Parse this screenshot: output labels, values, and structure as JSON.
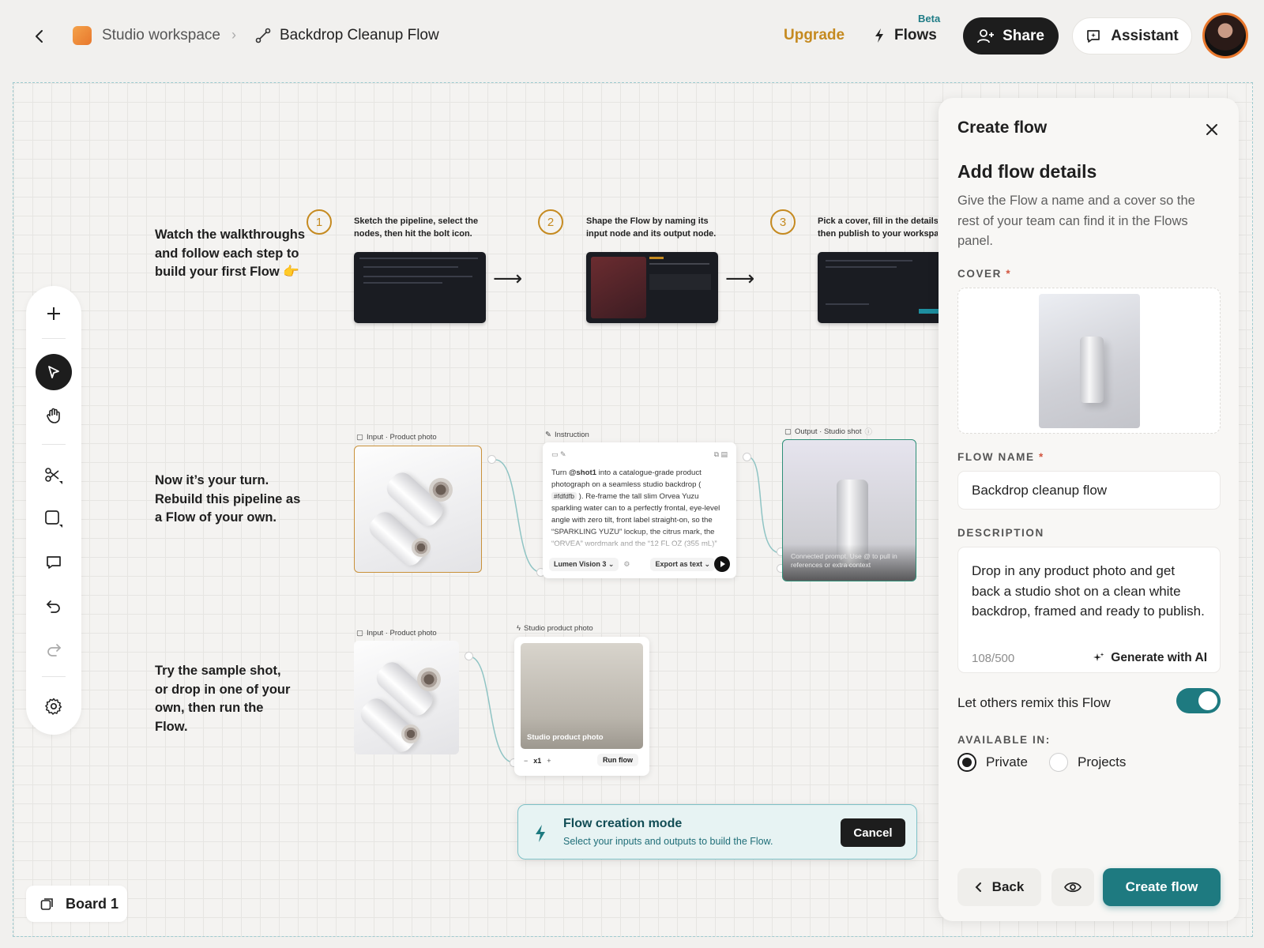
{
  "header": {
    "workspace_name": "Studio workspace",
    "flow_title": "Backdrop Cleanup Flow",
    "upgrade_label": "Upgrade",
    "flows_label": "Flows",
    "flows_badge": "Beta",
    "share_label": "Share",
    "assistant_label": "Assistant"
  },
  "canvas": {
    "captions": {
      "intro": "Watch the walkthroughs and follow each step to build your first Flow 👉",
      "turn": "Now it’s your turn. Rebuild this pipeline as a Flow of your own.",
      "try": "Try the sample shot, or drop in one of your own, then run the Flow."
    },
    "steps": [
      {
        "num": "1",
        "text": "Sketch the pipeline, select the nodes, then hit the bolt icon."
      },
      {
        "num": "2",
        "text": "Shape the Flow by naming its input node and its output node."
      },
      {
        "num": "3",
        "text": "Pick a cover, fill in the details, then publish to your workspace."
      }
    ],
    "arrow_glyph": "⟶",
    "nodes": {
      "input1_label": "Input · Product photo",
      "instruction_label": "Instruction",
      "instruction_text_pre": "Turn ",
      "instruction_mention": "@shot1",
      "instruction_text_mid": " into a catalogue-grade product photograph on a seamless studio backdrop ( ",
      "instruction_hex": "#fdfdfb",
      "instruction_text_post": " ). Re-frame the tall slim Orvea Yuzu sparkling water can to a perfectly frontal, eye-level angle with zero tilt, front label straight-on, so the “SPARKLING YUZU” lockup, the citrus mark, the “ORVEA” wordmark and the “12 FL OZ (355 mL)”",
      "model_label": "Lumen Vision 3",
      "export_label": "Export as text",
      "output_label": "Output · Studio shot",
      "output_overlay": "Connected prompt. Use @ to pull in references or extra context",
      "input2_label": "Input · Product photo",
      "studio_label": "Studio product photo",
      "studio_img_label": "Studio product photo",
      "stepper_minus": "−",
      "stepper_value": "x1",
      "stepper_plus": "+",
      "run_label": "Run flow"
    },
    "toast": {
      "title": "Flow creation mode",
      "subtitle": "Select your inputs and outputs to build the Flow.",
      "cancel_label": "Cancel"
    },
    "board_label": "Board 1"
  },
  "panel": {
    "title": "Create flow",
    "heading": "Add flow details",
    "description": "Give the Flow a name and a cover so the rest of your team can find it in the Flows panel.",
    "cover_label": "COVER",
    "required_mark": "*",
    "name_label": "FLOW NAME",
    "name_value": "Backdrop cleanup flow",
    "description_label": "DESCRIPTION",
    "description_value": "Drop in any product photo and get back a studio shot on a clean white backdrop, framed and ready to publish.",
    "counter": "108/500",
    "generate_label": "Generate with AI",
    "remix_label": "Let others remix this Flow",
    "remix_enabled": true,
    "available_label": "AVAILABLE IN:",
    "options": [
      "Private",
      "Projects"
    ],
    "selected_option": "Private",
    "back_label": "Back",
    "create_label": "Create flow"
  },
  "colors": {
    "accent": "#1e7a80",
    "upgrade": "#c58a20",
    "output_border": "#2e8f78",
    "input_border": "#c9913a"
  }
}
